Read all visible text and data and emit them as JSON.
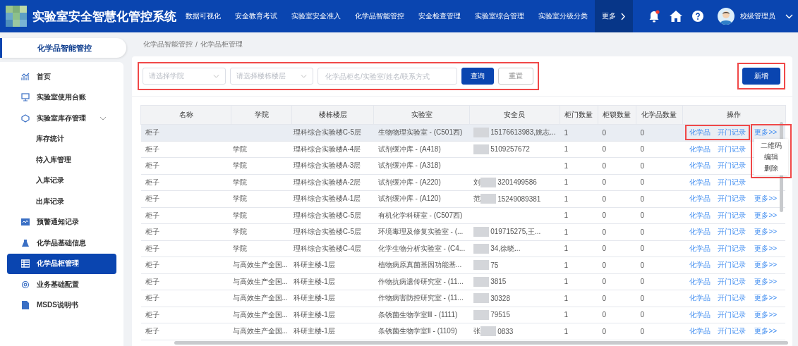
{
  "header": {
    "title": "实验室安全智慧化管控系统",
    "nav": [
      {
        "label": "数据可视化",
        "selected": false
      },
      {
        "label": "安全教育考试",
        "selected": false
      },
      {
        "label": "实验室安全准入",
        "selected": false
      },
      {
        "label": "化学品智能管控",
        "selected": false
      },
      {
        "label": "安全检查管理",
        "selected": false
      },
      {
        "label": "实验室综合管理",
        "selected": false
      },
      {
        "label": "实验室分级分类",
        "selected": false
      },
      {
        "label": "更多",
        "selected": true
      }
    ],
    "notification_dot": true,
    "user": "校级管理员"
  },
  "sidebar": {
    "module": "化学品智能管控",
    "items": [
      {
        "label": "首页",
        "selected": false
      },
      {
        "label": "实验室使用台账",
        "selected": false
      },
      {
        "label": "实验室库存管理",
        "selected": false,
        "expanded": true,
        "children": [
          {
            "label": "库存统计",
            "selected": false
          },
          {
            "label": "待入库管理",
            "selected": false
          },
          {
            "label": "入库记录",
            "selected": false
          },
          {
            "label": "出库记录",
            "selected": false
          }
        ]
      },
      {
        "label": "预警通知记录",
        "selected": false
      },
      {
        "label": "化学品基础信息",
        "selected": false
      },
      {
        "label": "化学品柜管理",
        "selected": true
      },
      {
        "label": "业务基础配置",
        "selected": false
      },
      {
        "label": "MSDS说明书",
        "selected": false
      }
    ]
  },
  "breadcrumb": [
    "化学品智能管控",
    "化学品柜管理"
  ],
  "breadcrumb_separator": "/",
  "filters": {
    "highlighted": true,
    "college": {
      "placeholder": "请选择学院"
    },
    "building": {
      "placeholder": "请选择楼栋楼层"
    },
    "search": {
      "placeholder": "化学品柜名/实验室/姓名/联系方式"
    },
    "query_button": "查询",
    "reset_button": "重置"
  },
  "add_button": {
    "label": "新增",
    "highlighted": true
  },
  "table": {
    "columns": [
      "名称",
      "学院",
      "楼栋楼层",
      "实验室",
      "安全员",
      "柜门数量",
      "柜锁数量",
      "化学品数量",
      "操作"
    ],
    "rows": [
      {
        "name": "柜子",
        "college": "",
        "building": "理科综合实验楼C-5层",
        "lab": "生物物理实验室 - (C501西)",
        "safety_before": "",
        "redacted": true,
        "safety_after": "15176613983,姚志...",
        "doors": "1",
        "locks": "0",
        "chemicals": "0",
        "actions": [
          "化学品",
          "开门记录",
          "更多>>"
        ],
        "selected": true
      },
      {
        "name": "柜子",
        "college": "学院",
        "building": "理科综合实验楼A-4层",
        "lab": "试剂缓冲库 - (A418)",
        "safety_before": "",
        "redacted": true,
        "safety_after": "5109257672",
        "doors": "1",
        "locks": "0",
        "chemicals": "0",
        "actions": [
          "化学品",
          "开门记录"
        ],
        "selected": false
      },
      {
        "name": "柜子",
        "college": "学院",
        "building": "理科综合实验楼A-3层",
        "lab": "试剂缓冲库 - (A318)",
        "safety_before": "",
        "redacted": false,
        "safety_after": "",
        "doors": "1",
        "locks": "0",
        "chemicals": "0",
        "actions": [
          "化学品",
          "开门记录"
        ],
        "selected": false
      },
      {
        "name": "柜子",
        "college": "学院",
        "building": "理科综合实验楼A-2层",
        "lab": "试剂缓冲库 - (A220)",
        "safety_before": "刘",
        "redacted": true,
        "safety_after": "3201499586",
        "doors": "1",
        "locks": "0",
        "chemicals": "0",
        "actions": [
          "化学品",
          "开门记录"
        ],
        "selected": false
      },
      {
        "name": "柜子",
        "college": "学院",
        "building": "理科综合实验楼A-1层",
        "lab": "试剂缓冲库 - (A120)",
        "safety_before": "范",
        "redacted": true,
        "safety_after": "15249089381",
        "doors": "1",
        "locks": "0",
        "chemicals": "0",
        "actions": [
          "化学品",
          "开门记录",
          "更多>>"
        ],
        "selected": false
      },
      {
        "name": "柜子",
        "college": "学院",
        "building": "理科综合实验楼C-5层",
        "lab": "有机化学科研室 - (C507西)",
        "safety_before": "",
        "redacted": false,
        "safety_after": "",
        "doors": "1",
        "locks": "0",
        "chemicals": "0",
        "actions": [
          "化学品",
          "开门记录",
          "更多>>"
        ],
        "selected": false
      },
      {
        "name": "柜子",
        "college": "学院",
        "building": "理科综合实验楼C-5层",
        "lab": "环境毒理及修复实验室 - (...",
        "safety_before": "",
        "redacted": true,
        "safety_after": "019715275,王...",
        "doors": "1",
        "locks": "0",
        "chemicals": "0",
        "actions": [
          "化学品",
          "开门记录",
          "更多>>"
        ],
        "selected": false
      },
      {
        "name": "柜子",
        "college": "学院",
        "building": "理科综合实验楼C-4层",
        "lab": "化学生物分析实验室 - (C4...",
        "safety_before": "",
        "redacted": true,
        "safety_after": "34,徐晓...",
        "doors": "1",
        "locks": "0",
        "chemicals": "0",
        "actions": [
          "化学品",
          "开门记录",
          "更多>>"
        ],
        "selected": false
      },
      {
        "name": "柜子",
        "college": "与高效生产全国...",
        "building": "科研主楼-1层",
        "lab": "植物病原真菌基因功能基...",
        "safety_before": "",
        "redacted": true,
        "safety_after": "75",
        "doors": "1",
        "locks": "0",
        "chemicals": "0",
        "actions": [
          "化学品",
          "开门记录",
          "更多>>"
        ],
        "selected": false
      },
      {
        "name": "柜子",
        "college": "与高效生产全国...",
        "building": "科研主楼-1层",
        "lab": "作物抗病遗传研究室 - (11...",
        "safety_before": "",
        "redacted": true,
        "safety_after": "3815",
        "doors": "1",
        "locks": "0",
        "chemicals": "0",
        "actions": [
          "化学品",
          "开门记录",
          "更多>>"
        ],
        "selected": false
      },
      {
        "name": "柜子",
        "college": "与高效生产全国...",
        "building": "科研主楼-1层",
        "lab": "作物病害防控研究室 - (11...",
        "safety_before": "",
        "redacted": true,
        "safety_after": "30328",
        "doors": "1",
        "locks": "0",
        "chemicals": "0",
        "actions": [
          "化学品",
          "开门记录",
          "更多>>"
        ],
        "selected": false
      },
      {
        "name": "柜子",
        "college": "与高效生产全国...",
        "building": "科研主楼-1层",
        "lab": "条锈菌生物学室Ⅲ - (1111)",
        "safety_before": "",
        "redacted": true,
        "safety_after": "79515",
        "doors": "1",
        "locks": "0",
        "chemicals": "0",
        "actions": [
          "化学品",
          "开门记录",
          "更多>>"
        ],
        "selected": false
      },
      {
        "name": "柜子",
        "college": "与高效生产全国...",
        "building": "科研主楼-1层",
        "lab": "条锈菌生物学室Ⅱ - (1109)",
        "safety_before": "张",
        "redacted": true,
        "safety_after": "0833",
        "doors": "1",
        "locks": "0",
        "chemicals": "0",
        "actions": [
          "化学品",
          "开门记录",
          "更多>>"
        ],
        "selected": false
      }
    ]
  },
  "row_actions_highlighted": true,
  "more_menu": {
    "open": true,
    "highlighted": true,
    "items": [
      "二维码",
      "编辑",
      "删除"
    ]
  }
}
